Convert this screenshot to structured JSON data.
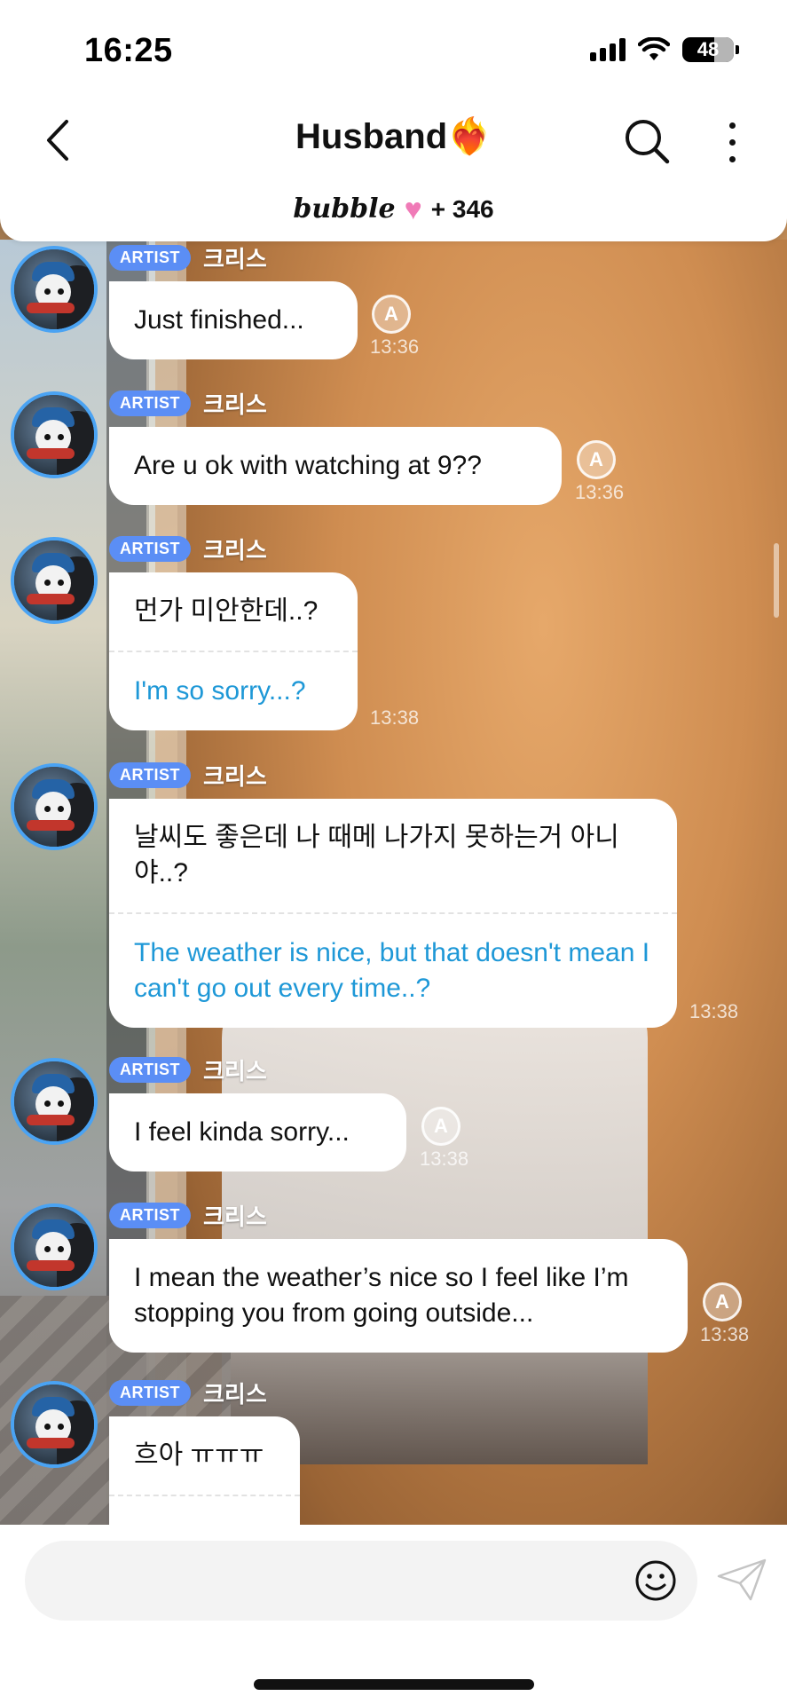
{
  "status_bar": {
    "time": "16:25",
    "battery": "48"
  },
  "header": {
    "title": "Husband❤️‍🔥",
    "brand": "bubble",
    "count": "+ 346"
  },
  "messages": [
    {
      "badge": "ARTIST",
      "nick": "크리스",
      "text": "Just finished...",
      "translation": "",
      "time": "13:36"
    },
    {
      "badge": "ARTIST",
      "nick": "크리스",
      "text": "Are u ok with watching at 9??",
      "translation": "",
      "time": "13:36"
    },
    {
      "badge": "ARTIST",
      "nick": "크리스",
      "text": "먼가 미안한데..?",
      "translation": "I'm so sorry...?",
      "time": "13:38"
    },
    {
      "badge": "ARTIST",
      "nick": "크리스",
      "text": "날씨도 좋은데 나 때메 나가지 못하는거 아니야..?",
      "translation": "The weather is nice, but that doesn't mean I can't go out every time..?",
      "time": "13:38"
    },
    {
      "badge": "ARTIST",
      "nick": "크리스",
      "text": "I feel kinda sorry...",
      "translation": "",
      "time": "13:38"
    },
    {
      "badge": "ARTIST",
      "nick": "크리스",
      "text": "I mean the weather’s nice so I feel like I’m stopping you from going outside...",
      "translation": "",
      "time": "13:38"
    },
    {
      "badge": "ARTIST",
      "nick": "크리스",
      "text": "흐아 ㅠㅠㅠ",
      "translation": "",
      "time": ""
    }
  ],
  "icons": {
    "back": "chevron-left-icon",
    "search": "search-icon",
    "more": "more-vertical-icon",
    "translate": "translate-icon",
    "emoji": "smiley-icon",
    "send": "paper-plane-icon"
  },
  "colors": {
    "accent": "#5b8ef5",
    "translation_text": "#1e98d7",
    "avatar_ring": "#4aa3f3",
    "heart": "#f07ab7"
  }
}
